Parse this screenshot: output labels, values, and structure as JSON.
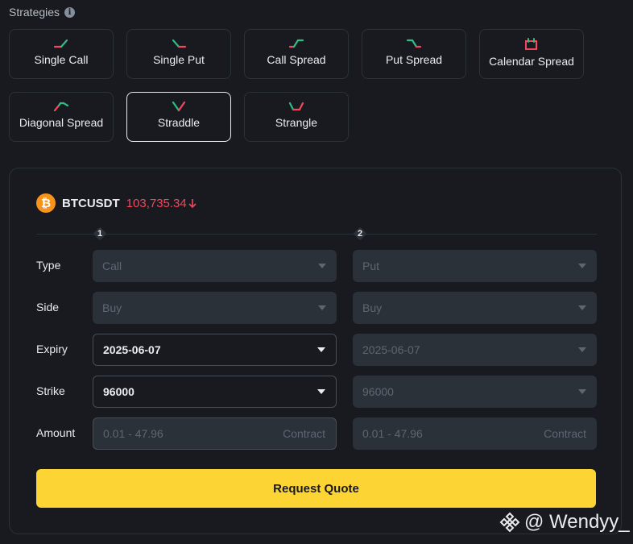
{
  "header": {
    "title": "Strategies",
    "info_icon": "info-icon"
  },
  "strategies": [
    {
      "label": "Single Call",
      "icon": "single-call-icon"
    },
    {
      "label": "Single Put",
      "icon": "single-put-icon"
    },
    {
      "label": "Call Spread",
      "icon": "call-spread-icon"
    },
    {
      "label": "Put Spread",
      "icon": "put-spread-icon"
    },
    {
      "label": "Calendar Spread",
      "icon": "calendar-spread-icon"
    },
    {
      "label": "Diagonal Spread",
      "icon": "diagonal-spread-icon"
    },
    {
      "label": "Straddle",
      "icon": "straddle-icon",
      "selected": true
    },
    {
      "label": "Strangle",
      "icon": "strangle-icon"
    }
  ],
  "ticker": {
    "symbol": "BTCUSDT",
    "price": "103,735.34",
    "direction": "down",
    "price_color": "#f6465d"
  },
  "legs": [
    "1",
    "2"
  ],
  "rows": {
    "type": {
      "label": "Type",
      "leg1": "Call",
      "leg2": "Put"
    },
    "side": {
      "label": "Side",
      "leg1": "Buy",
      "leg2": "Buy"
    },
    "expiry": {
      "label": "Expiry",
      "leg1": "2025-06-07",
      "leg2": "2025-06-07"
    },
    "strike": {
      "label": "Strike",
      "leg1": "96000",
      "leg2": "96000"
    },
    "amount": {
      "label": "Amount",
      "placeholder1": "0.01 - 47.96",
      "placeholder2": "0.01 - 47.96",
      "unit": "Contract"
    }
  },
  "action": {
    "label": "Request Quote",
    "color": "#fcd535"
  },
  "watermark": {
    "text": "@ Wendyy_"
  },
  "colors": {
    "up": "#2ebd85",
    "down": "#f6465d"
  }
}
